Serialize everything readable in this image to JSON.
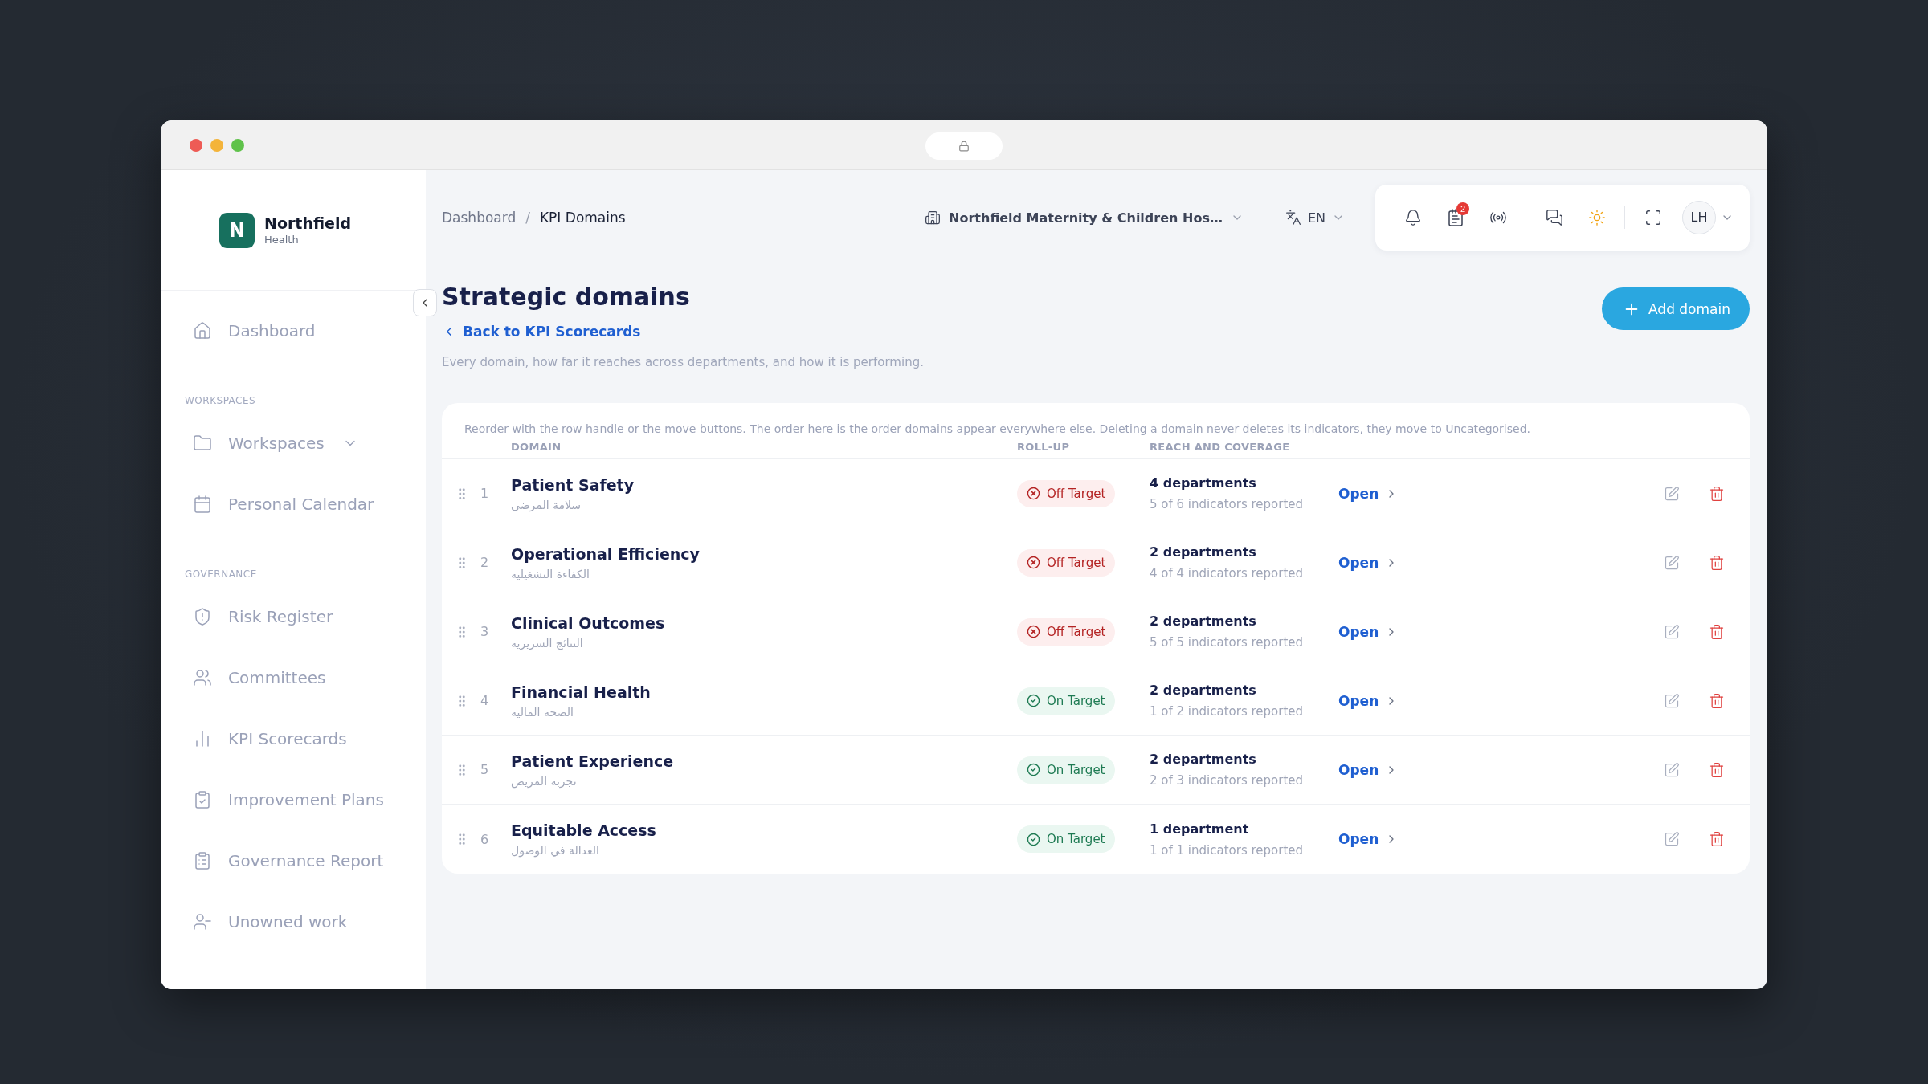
{
  "brand": {
    "name": "Northfield",
    "sub": "Health",
    "mark": "N"
  },
  "sidebar": {
    "top": [
      {
        "label": "Dashboard"
      }
    ],
    "sections": [
      {
        "title": "WORKSPACES",
        "items": [
          {
            "label": "Workspaces",
            "expandable": true
          },
          {
            "label": "Personal Calendar"
          }
        ]
      },
      {
        "title": "GOVERNANCE",
        "items": [
          {
            "label": "Risk Register"
          },
          {
            "label": "Committees"
          },
          {
            "label": "KPI Scorecards"
          },
          {
            "label": "Improvement Plans"
          },
          {
            "label": "Governance Report"
          },
          {
            "label": "Unowned work"
          }
        ]
      }
    ]
  },
  "breadcrumb": [
    "Dashboard",
    "KPI Domains"
  ],
  "breadcrumb_separator": "/",
  "organization": "Northfield Maternity & Children Hos…",
  "language": "EN",
  "notifications_count": "2",
  "user_initials": "LH",
  "page": {
    "title": "Strategic domains",
    "back_link": "Back to KPI Scorecards",
    "description": "Every domain, how far it reaches across departments, and how it is performing.",
    "add_button": "Add domain"
  },
  "table": {
    "note": "Reorder with the row handle or the move buttons. The order here is the order domains appear everywhere else. Deleting a domain never deletes its indicators, they move to Uncategorised.",
    "columns": [
      "DOMAIN",
      "ROLL-UP",
      "REACH AND COVERAGE"
    ],
    "rows": [
      {
        "index": "1",
        "name": "Patient Safety",
        "name_ar": "سلامة المرضى",
        "kind": "off",
        "status_label": "Off Target",
        "reach": "4 departments",
        "coverage": "5 of 6 indicators reported",
        "action": "Open"
      },
      {
        "index": "2",
        "name": "Operational Efficiency",
        "name_ar": "الكفاءة التشغيلية",
        "kind": "off",
        "status_label": "Off Target",
        "reach": "2 departments",
        "coverage": "4 of 4 indicators reported",
        "action": "Open"
      },
      {
        "index": "3",
        "name": "Clinical Outcomes",
        "name_ar": "النتائج السريرية",
        "kind": "off",
        "status_label": "Off Target",
        "reach": "2 departments",
        "coverage": "5 of 5 indicators reported",
        "action": "Open"
      },
      {
        "index": "4",
        "name": "Financial Health",
        "name_ar": "الصحة المالية",
        "kind": "on",
        "status_label": "On Target",
        "reach": "2 departments",
        "coverage": "1 of 2 indicators reported",
        "action": "Open"
      },
      {
        "index": "5",
        "name": "Patient Experience",
        "name_ar": "تجربة المريض",
        "kind": "on",
        "status_label": "On Target",
        "reach": "2 departments",
        "coverage": "2 of 3 indicators reported",
        "action": "Open"
      },
      {
        "index": "6",
        "name": "Equitable Access",
        "name_ar": "العدالة في الوصول",
        "kind": "on",
        "status_label": "On Target",
        "reach": "1 department",
        "coverage": "1 of 1 indicators reported",
        "action": "Open"
      }
    ]
  }
}
